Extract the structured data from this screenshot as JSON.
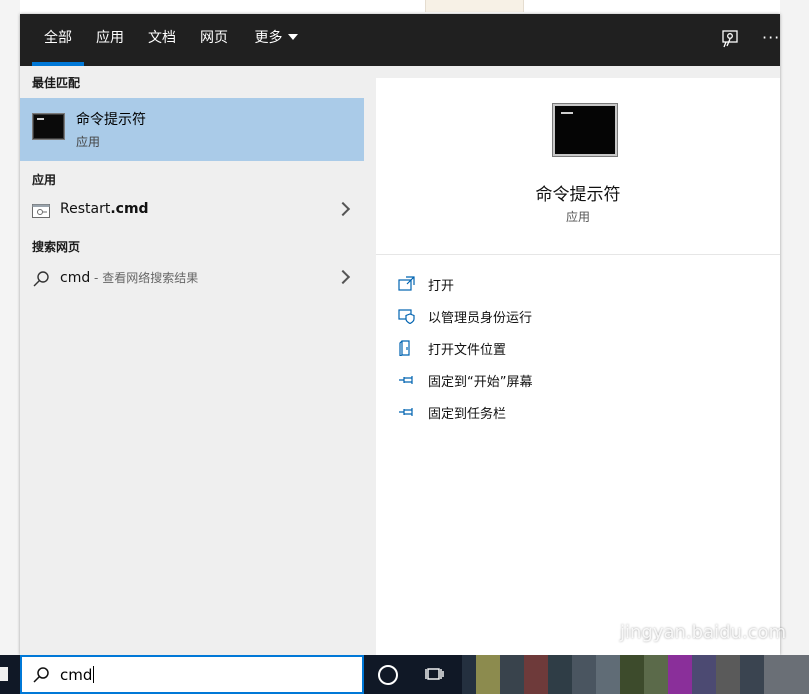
{
  "tabs": [
    {
      "label": "全部",
      "active": true
    },
    {
      "label": "应用",
      "active": false
    },
    {
      "label": "文档",
      "active": false
    },
    {
      "label": "网页",
      "active": false
    },
    {
      "label": "更多",
      "active": false
    }
  ],
  "topbar_icons": {
    "feedback": "feedback-icon",
    "more": "···"
  },
  "left": {
    "best_match_header": "最佳匹配",
    "best_match": {
      "title": "命令提示符",
      "subtitle": "应用",
      "icon": "cmd-icon"
    },
    "apps_header": "应用",
    "app_item": {
      "name": "Restart",
      "ext": ".cmd",
      "icon": "script-file-icon"
    },
    "web_header": "搜索网页",
    "web_item": {
      "query": "cmd",
      "suffix": " - 查看网络搜索结果",
      "icon": "search-icon"
    }
  },
  "right": {
    "title": "命令提示符",
    "subtitle": "应用",
    "actions": [
      {
        "label": "打开",
        "icon": "open-icon"
      },
      {
        "label": "以管理员身份运行",
        "icon": "shield-icon"
      },
      {
        "label": "打开文件位置",
        "icon": "folder-icon"
      },
      {
        "label": "固定到“开始”屏幕",
        "icon": "pin-icon"
      },
      {
        "label": "固定到任务栏",
        "icon": "pin-icon"
      }
    ]
  },
  "search": {
    "value": "cmd"
  },
  "watermark": "jingyan.baidu.com",
  "colors": {
    "accent": "#0078d7",
    "topbar": "#202020",
    "selection": "#aacbe8",
    "panel": "#efefef"
  }
}
